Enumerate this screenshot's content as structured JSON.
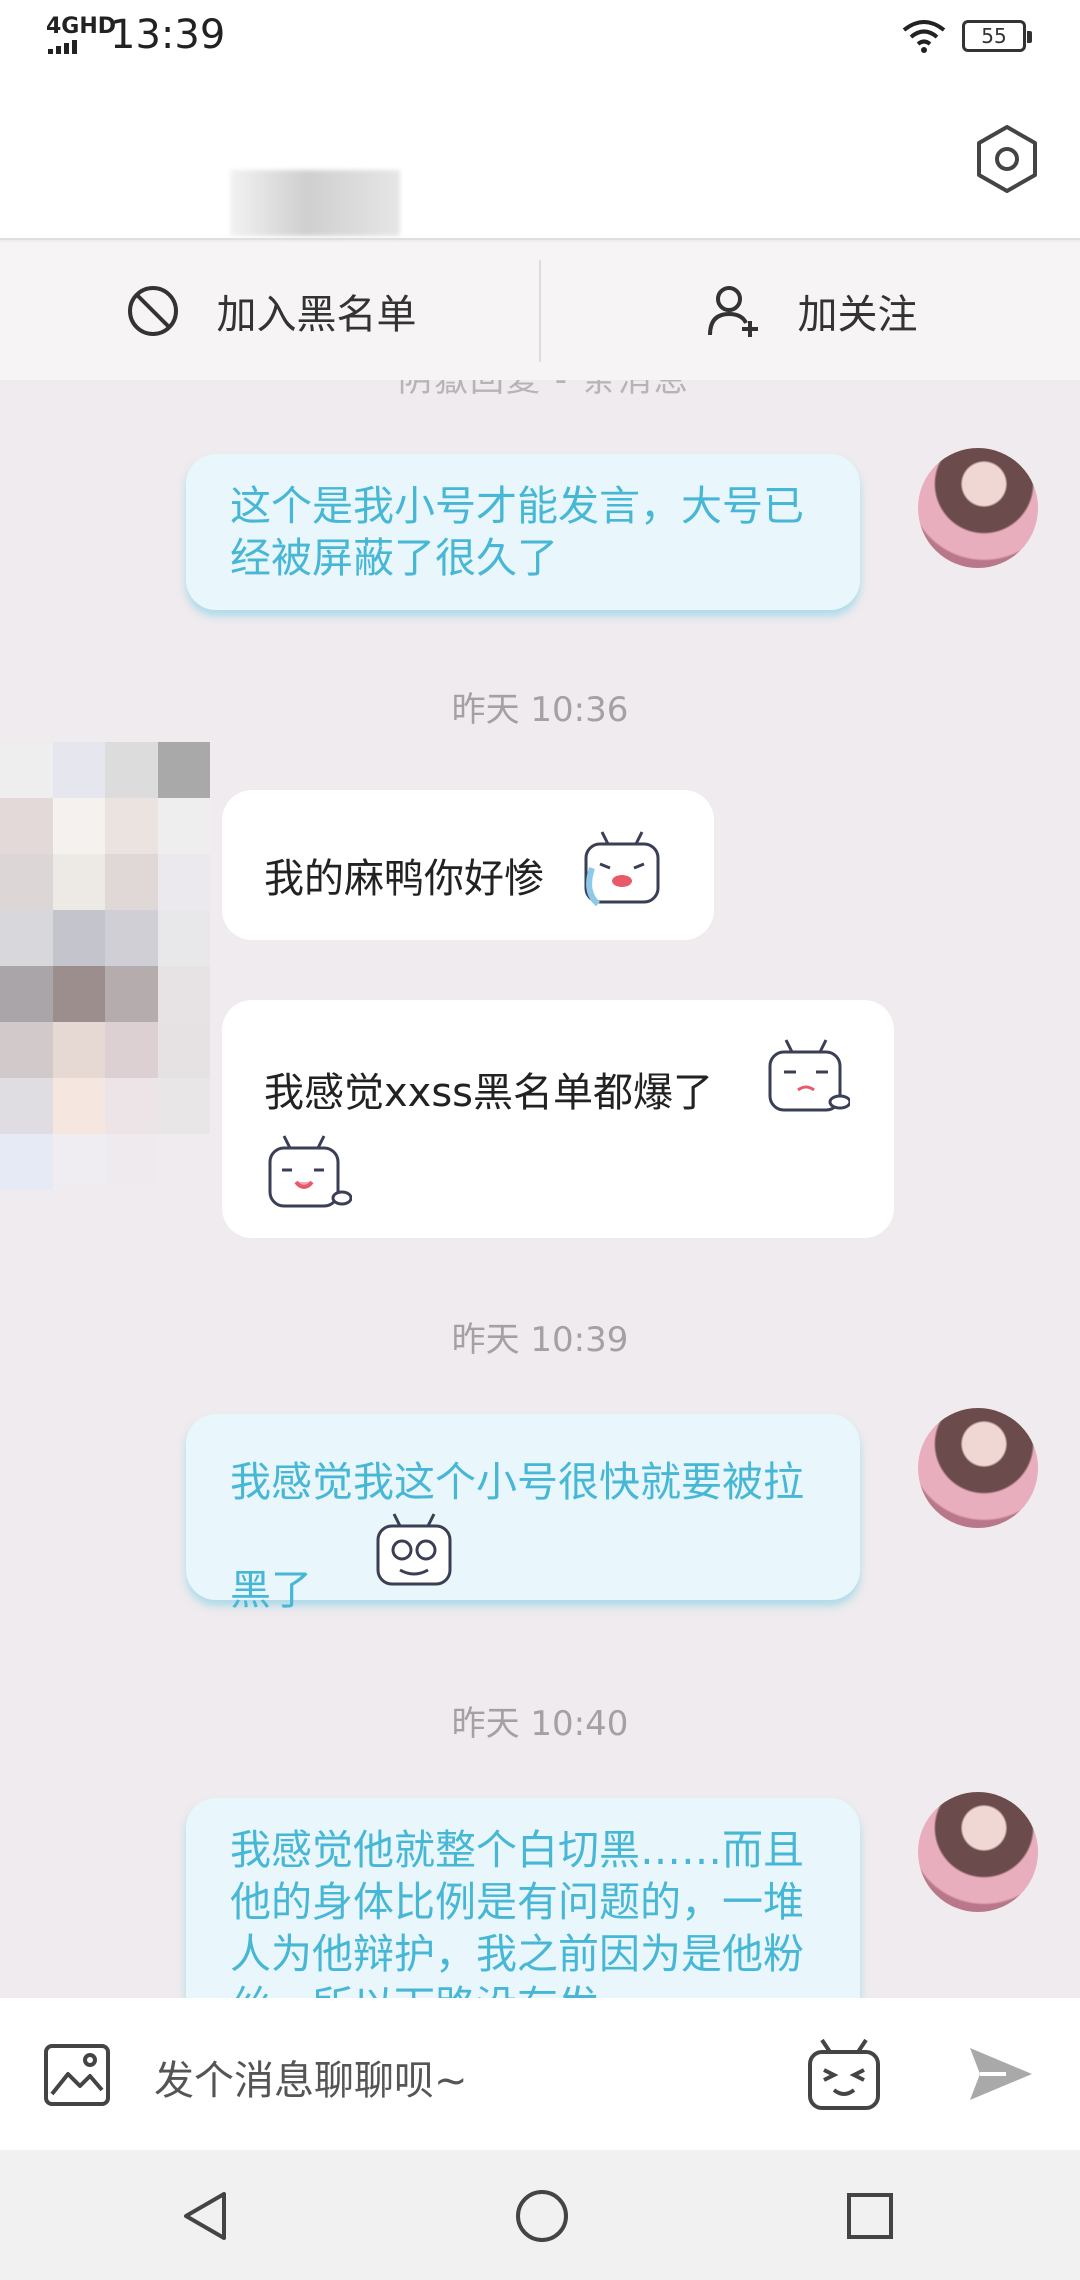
{
  "status_bar": {
    "network": "4GHD",
    "time": "13:39",
    "battery": "55"
  },
  "action_bar": {
    "blacklist_label": "加入黑名单",
    "follow_label": "加关注"
  },
  "chat": {
    "cut_top_text": "阴嶽回复 - 条消息",
    "timestamps": [
      "昨天 10:36",
      "昨天 10:39",
      "昨天 10:40"
    ],
    "messages": [
      {
        "from": "me",
        "text": "这个是我小号才能发言，大号已经被屏蔽了很久了"
      },
      {
        "from": "them",
        "text": "我的麻鸭你好惨",
        "emoji": "crying-tv-emoji"
      },
      {
        "from": "them",
        "text": "我感觉xxss黑名单都爆了",
        "emoji": "awkward-tv-emoji, smiling-tv-emoji"
      },
      {
        "from": "me",
        "text": "我感觉我这个小号很快就要被拉黑了",
        "emoji": "glasses-tv-emoji"
      },
      {
        "from": "me",
        "text": "我感觉他就整个白切黑……而且他的身体比例是有问题的，一堆人为他辩护，我之前因为是他粉丝，所以下路没有发"
      }
    ]
  },
  "input": {
    "placeholder": "发个消息聊聊呗~"
  },
  "icons": [
    "settings-hex-icon",
    "block-icon",
    "add-user-icon",
    "image-icon",
    "emoji-tv-icon",
    "send-icon",
    "nav-back-icon",
    "nav-home-icon",
    "nav-recent-icon"
  ],
  "colors": {
    "my_bubble_bg": "#e9f6fb",
    "my_text": "#47b7d6",
    "chat_bg": "#efebee"
  }
}
